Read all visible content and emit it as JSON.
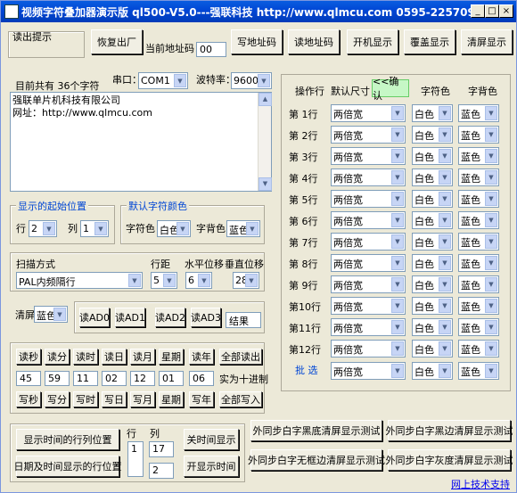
{
  "window": {
    "title": "视频字符叠加器演示版 ql500-V5.0---强联科技 http://www.qlmcu.com 0595-22570937",
    "min": "_",
    "max": "□",
    "close": "×"
  },
  "top": {
    "read_hint": "读出提示",
    "restore_btn": "恢复出厂",
    "addr_label": "当前地址码：",
    "addr_value": "00",
    "write_addr_btn": "写地址码",
    "read_addr_btn": "读地址码",
    "boot_btn": "开机显示",
    "cover_btn": "覆盖显示",
    "clear_btn": "清屏显示"
  },
  "text": {
    "count": "目前共有 36个字符",
    "port_label": "串口：",
    "port_value": "COM1",
    "baud_label": "波特率：",
    "baud_value": "9600",
    "line1": "强联单片机科技有限公司",
    "line2": "网址：http://www.qlmcu.com"
  },
  "pos": {
    "title": "显示的起始位置",
    "row_label": "行",
    "row_value": "2",
    "col_label": "列",
    "col_value": "1"
  },
  "color": {
    "title": "默认字符颜色",
    "fg_label": "字符色",
    "fg_value": "白色",
    "bg_label": "字背色",
    "bg_value": "蓝色"
  },
  "scan": {
    "scan_label": "扫描方式",
    "scan_value": "PAL内频隔行",
    "pitch_label": "行距",
    "pitch_value": "5",
    "hoff_label": "水平位移",
    "hoff_value": "6",
    "voff_label": "垂直位移",
    "voff_value": "28"
  },
  "clearscr": {
    "label": "清屏",
    "value": "蓝色"
  },
  "ad": {
    "ad0": "读AD0",
    "ad1": "读AD1",
    "ad2": "读AD2",
    "ad3": "读AD3",
    "result": "结果"
  },
  "time": {
    "read_labels": [
      "读秒",
      "读分",
      "读时",
      "读日",
      "读月",
      "星期",
      "读年"
    ],
    "read_all": "全部读出",
    "values": [
      "45",
      "59",
      "11",
      "02",
      "12",
      "01",
      "06"
    ],
    "hex_note": "实为十进制",
    "write_labels": [
      "写秒",
      "写分",
      "写时",
      "写日",
      "写月",
      "星期",
      "写年"
    ],
    "write_all": "全部写入"
  },
  "timepos": {
    "time_rc_btn": "显示时间的行列位置",
    "date_rc_btn": "日期及时间显示的行位置",
    "row_label": "行",
    "col_label": "列",
    "row_value": "1",
    "col_value": "17",
    "col2_value": "2",
    "off_btn": "关时间显示",
    "on_btn": "开显示时间"
  },
  "table": {
    "hdr_op": "操作行",
    "hdr_size": "默认尺寸",
    "hdr_ok": "<<确认",
    "hdr_fg": "字符色",
    "hdr_bg": "字背色",
    "rows": [
      {
        "label": "第 1行",
        "size": "两倍宽",
        "fg": "白色",
        "bg": "蓝色"
      },
      {
        "label": "第 2行",
        "size": "两倍宽",
        "fg": "白色",
        "bg": "蓝色"
      },
      {
        "label": "第 3行",
        "size": "两倍宽",
        "fg": "白色",
        "bg": "蓝色"
      },
      {
        "label": "第 4行",
        "size": "两倍宽",
        "fg": "白色",
        "bg": "蓝色"
      },
      {
        "label": "第 5行",
        "size": "两倍宽",
        "fg": "白色",
        "bg": "蓝色"
      },
      {
        "label": "第 6行",
        "size": "两倍宽",
        "fg": "白色",
        "bg": "蓝色"
      },
      {
        "label": "第 7行",
        "size": "两倍宽",
        "fg": "白色",
        "bg": "蓝色"
      },
      {
        "label": "第 8行",
        "size": "两倍宽",
        "fg": "白色",
        "bg": "蓝色"
      },
      {
        "label": "第 9行",
        "size": "两倍宽",
        "fg": "白色",
        "bg": "蓝色"
      },
      {
        "label": "第10行",
        "size": "两倍宽",
        "fg": "白色",
        "bg": "蓝色"
      },
      {
        "label": "第11行",
        "size": "两倍宽",
        "fg": "白色",
        "bg": "蓝色"
      },
      {
        "label": "第12行",
        "size": "两倍宽",
        "fg": "白色",
        "bg": "蓝色"
      }
    ],
    "batch_label": "批 选",
    "batch_size": "两倍宽",
    "batch_fg": "白色",
    "batch_bg": "蓝色"
  },
  "tests": {
    "t1": "外同步白字黑底清屏显示测试",
    "t2": "外同步白字黑边清屏显示测试",
    "t3": "外同步白字无框边清屏显示测试",
    "t4": "外同步白字灰度清屏显示测试"
  },
  "support_link": "网上技术支持"
}
